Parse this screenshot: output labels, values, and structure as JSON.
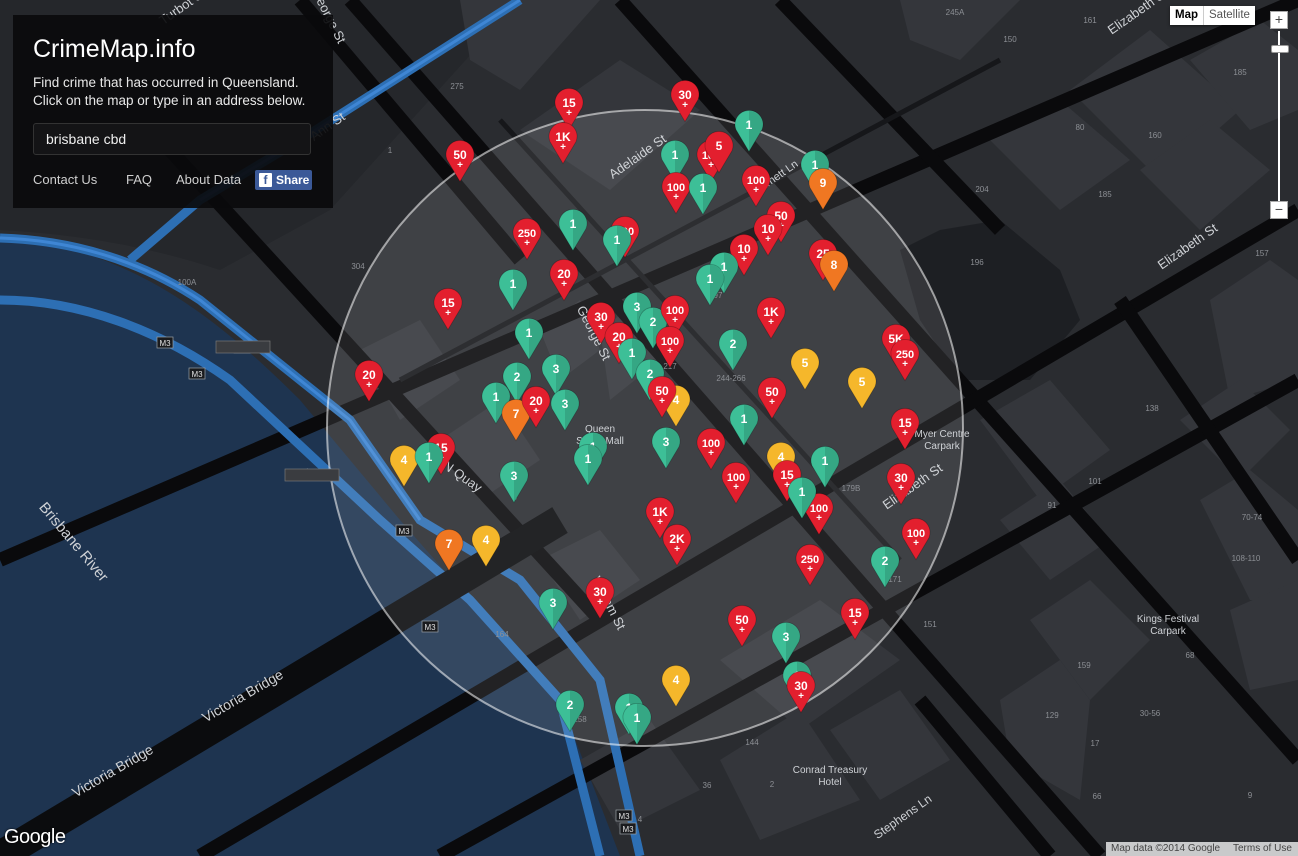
{
  "app": {
    "title": "CrimeMap.info",
    "description": [
      "Find crime that has occurred in Queensland.",
      "Click on the map or type in an address below."
    ],
    "search_value": "brisbane cbd",
    "links": [
      "Contact Us",
      "FAQ",
      "About Data"
    ],
    "share_label": "Share"
  },
  "map_controls": {
    "map_type": [
      "Map",
      "Satellite"
    ],
    "active_type": "Map",
    "zoom_in": "+",
    "zoom_out": "−"
  },
  "attribution": {
    "logo": "Google",
    "map_data": "Map data ©2014 Google",
    "terms": "Terms of Use"
  },
  "colors": {
    "red": "#e31f2e",
    "green": "#3dbf97",
    "orange": "#f07722",
    "yellow": "#f5b72b",
    "water": "#1e3450",
    "road_blue": "#2d6fb4"
  },
  "street_labels": [
    "Turbot St",
    "George St",
    "Ann St",
    "Adelaide St",
    "Burnett Ln",
    "Elizabeth St",
    "George St",
    "Elizabeth St",
    "William St",
    "N Quay",
    "Stephens Ln",
    "Victoria Bridge",
    "Victoria Bridge",
    "Brisbane River",
    "Elizabeth St",
    "Turbot St"
  ],
  "place_labels": [
    "Queen Street Mall",
    "Myer Centre Carpark",
    "Kings Festival Carpark",
    "Conrad Treasury Hotel"
  ],
  "road_shields": [
    "M3",
    "M3",
    "M3",
    "M3",
    "M3",
    "M3",
    "M3"
  ],
  "building_numbers": [
    "245A",
    "150",
    "160",
    "185",
    "275",
    "304",
    "1",
    "4",
    "100A",
    "196",
    "204",
    "157",
    "185",
    "161",
    "138",
    "101",
    "91",
    "108-110",
    "70-74",
    "151",
    "171",
    "179B",
    "217",
    "244-266",
    "97",
    "164",
    "158",
    "144",
    "159",
    "129",
    "30-56",
    "17",
    "66",
    "68",
    "4",
    "36",
    "2",
    "9",
    "80"
  ],
  "markers": [
    {
      "label": "30",
      "kind": "red"
    },
    {
      "label": "15",
      "kind": "red"
    },
    {
      "label": "1K",
      "kind": "red"
    },
    {
      "label": "50",
      "kind": "red"
    },
    {
      "label": "1",
      "kind": "green"
    },
    {
      "label": "1",
      "kind": "green"
    },
    {
      "label": "100",
      "kind": "red"
    },
    {
      "label": "5",
      "kind": "red"
    },
    {
      "label": "100",
      "kind": "red"
    },
    {
      "label": "1",
      "kind": "green"
    },
    {
      "label": "100",
      "kind": "red"
    },
    {
      "label": "1",
      "kind": "green"
    },
    {
      "label": "9",
      "kind": "orange"
    },
    {
      "label": "250",
      "kind": "red"
    },
    {
      "label": "1",
      "kind": "green"
    },
    {
      "label": "100",
      "kind": "red"
    },
    {
      "label": "1",
      "kind": "green"
    },
    {
      "label": "50",
      "kind": "red"
    },
    {
      "label": "10",
      "kind": "red"
    },
    {
      "label": "10",
      "kind": "red"
    },
    {
      "label": "25",
      "kind": "red"
    },
    {
      "label": "8",
      "kind": "orange"
    },
    {
      "label": "20",
      "kind": "red"
    },
    {
      "label": "1",
      "kind": "green"
    },
    {
      "label": "1",
      "kind": "green"
    },
    {
      "label": "3",
      "kind": "green"
    },
    {
      "label": "15",
      "kind": "red"
    },
    {
      "label": "1",
      "kind": "green"
    },
    {
      "label": "30",
      "kind": "red"
    },
    {
      "label": "2",
      "kind": "green"
    },
    {
      "label": "100",
      "kind": "red"
    },
    {
      "label": "1K",
      "kind": "red"
    },
    {
      "label": "20",
      "kind": "red"
    },
    {
      "label": "1",
      "kind": "green"
    },
    {
      "label": "100",
      "kind": "red"
    },
    {
      "label": "5K",
      "kind": "red"
    },
    {
      "label": "250",
      "kind": "red"
    },
    {
      "label": "20",
      "kind": "red"
    },
    {
      "label": "2",
      "kind": "green"
    },
    {
      "label": "3",
      "kind": "green"
    },
    {
      "label": "1",
      "kind": "green"
    },
    {
      "label": "2",
      "kind": "green"
    },
    {
      "label": "2",
      "kind": "green"
    },
    {
      "label": "5",
      "kind": "yellow"
    },
    {
      "label": "5",
      "kind": "yellow"
    },
    {
      "label": "1",
      "kind": "green"
    },
    {
      "label": "50",
      "kind": "red"
    },
    {
      "label": "4",
      "kind": "yellow"
    },
    {
      "label": "50",
      "kind": "red"
    },
    {
      "label": "7",
      "kind": "orange"
    },
    {
      "label": "20",
      "kind": "red"
    },
    {
      "label": "3",
      "kind": "green"
    },
    {
      "label": "1",
      "kind": "green"
    },
    {
      "label": "15",
      "kind": "red"
    },
    {
      "label": "4",
      "kind": "yellow"
    },
    {
      "label": "1",
      "kind": "green"
    },
    {
      "label": "1",
      "kind": "green"
    },
    {
      "label": "3",
      "kind": "green"
    },
    {
      "label": "100",
      "kind": "red"
    },
    {
      "label": "4",
      "kind": "yellow"
    },
    {
      "label": "100",
      "kind": "red"
    },
    {
      "label": "15",
      "kind": "red"
    },
    {
      "label": "1",
      "kind": "green"
    },
    {
      "label": "1",
      "kind": "green"
    },
    {
      "label": "15",
      "kind": "red"
    },
    {
      "label": "30",
      "kind": "red"
    },
    {
      "label": "3",
      "kind": "green"
    },
    {
      "label": "100",
      "kind": "red"
    },
    {
      "label": "1",
      "kind": "green"
    },
    {
      "label": "100",
      "kind": "red"
    },
    {
      "label": "1K",
      "kind": "red"
    },
    {
      "label": "2K",
      "kind": "red"
    },
    {
      "label": "7",
      "kind": "orange"
    },
    {
      "label": "4",
      "kind": "yellow"
    },
    {
      "label": "250",
      "kind": "red"
    },
    {
      "label": "2",
      "kind": "green"
    },
    {
      "label": "30",
      "kind": "red"
    },
    {
      "label": "3",
      "kind": "green"
    },
    {
      "label": "50",
      "kind": "red"
    },
    {
      "label": "15",
      "kind": "red"
    },
    {
      "label": "3",
      "kind": "green"
    },
    {
      "label": "4",
      "kind": "yellow"
    },
    {
      "label": "1",
      "kind": "green"
    },
    {
      "label": "30",
      "kind": "red"
    },
    {
      "label": "2",
      "kind": "green"
    },
    {
      "label": "1",
      "kind": "green"
    },
    {
      "label": "1",
      "kind": "green"
    }
  ]
}
